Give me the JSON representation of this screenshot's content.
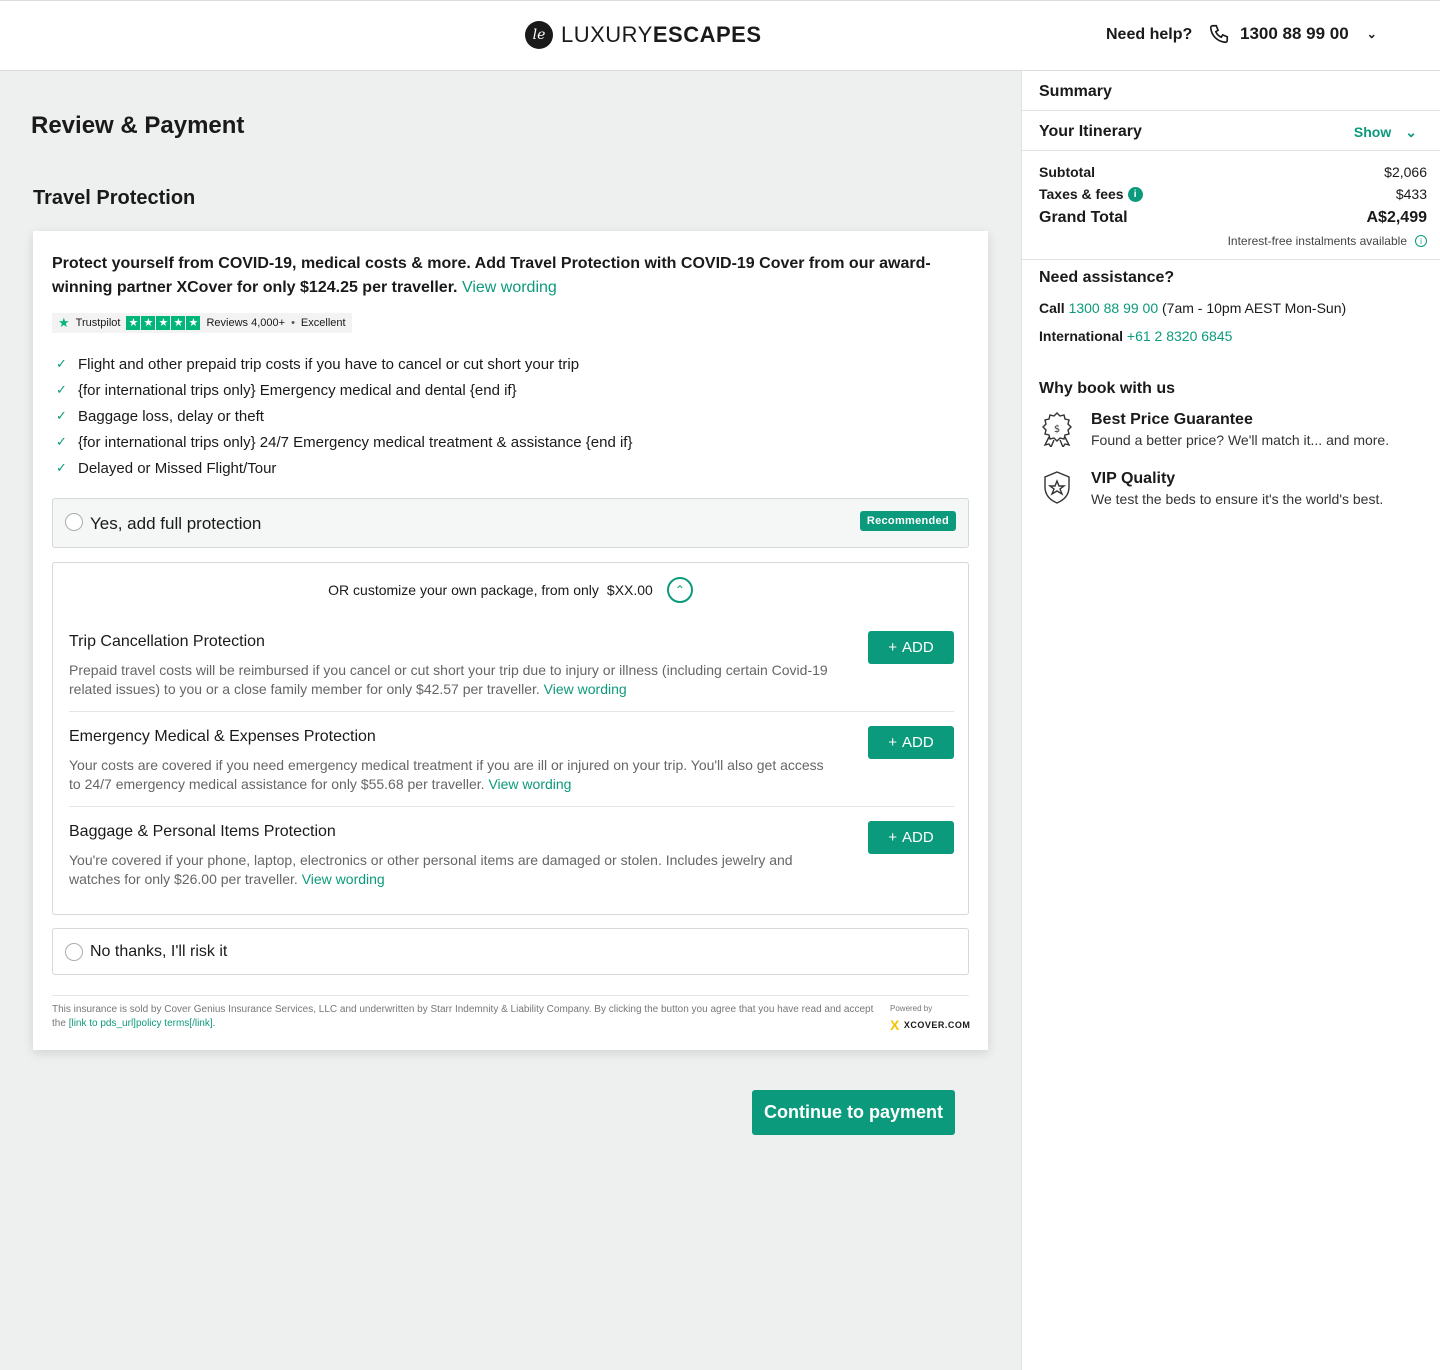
{
  "header": {
    "logo_mark": "le",
    "logo_light": "LUXURY",
    "logo_bold": "ESCAPES",
    "help_label": "Need help?",
    "phone": "1300 88 99 00"
  },
  "main": {
    "page_title": "Review & Payment",
    "section_title": "Travel Protection",
    "intro_text": "Protect yourself from COVID-19, medical costs & more. Add Travel Protection with COVID-19 Cover from our award-winning partner XCover for only $124.25 per traveller.",
    "intro_link": "View wording",
    "trustpilot": {
      "brand": "Trustpilot",
      "reviews": "Reviews 4,000+",
      "rating": "Excellent"
    },
    "features": [
      "Flight and other prepaid trip costs if you have to cancel or cut short your trip",
      "{for international trips only} Emergency medical and dental {end if}",
      "Baggage loss, delay or theft",
      "{for international trips only} 24/7 Emergency medical treatment & assistance {end if}",
      "Delayed or Missed Flight/Tour"
    ],
    "option_yes": "Yes, add full protection",
    "recommended_badge": "Recommended",
    "custom_heading": "OR customize your own package, from only",
    "custom_price": "$XX.00",
    "coverages": [
      {
        "title": "Trip Cancellation Protection",
        "desc": "Prepaid travel costs will be reimbursed if you cancel or cut short your trip due to injury or illness (including certain Covid-19 related issues) to you or a close family member for only $42.57 per traveller.",
        "link": "View wording",
        "button": "ADD"
      },
      {
        "title": "Emergency Medical & Expenses Protection",
        "desc": "Your costs are covered if you need emergency medical treatment if you are ill or injured on your trip. You'll also get access to 24/7 emergency medical assistance for only $55.68 per traveller.",
        "link": "View wording",
        "button": "ADD"
      },
      {
        "title": "Baggage & Personal Items Protection",
        "desc": "You're covered if your phone, laptop, electronics or other personal items are damaged or stolen. Includes jewelry and watches for only $26.00 per traveller.",
        "link": "View wording",
        "button": "ADD"
      }
    ],
    "option_no": "No thanks, I'll risk it",
    "legal_text": "This insurance is sold by Cover Genius Insurance Services, LLC and underwritten by Starr Indemnity & Liability Company. By clicking the button you agree that you have read and accept the",
    "legal_link": "[link to pds_url]policy terms[/link].",
    "powered_by": "Powered by",
    "xcover_brand": "XCOVER.COM",
    "continue_button": "Continue to payment"
  },
  "sidebar": {
    "summary_label": "Summary",
    "itinerary_label": "Your Itinerary",
    "show_label": "Show",
    "subtotal_label": "Subtotal",
    "subtotal_value": "$2,066",
    "taxes_label": "Taxes & fees",
    "taxes_value": "$433",
    "grand_total_label": "Grand Total",
    "grand_total_value": "A$2,499",
    "instalments_note": "Interest-free instalments available",
    "assistance_title": "Need assistance?",
    "call_label": "Call",
    "call_number": "1300 88 99 00",
    "call_hours": "(7am - 10pm AEST Mon-Sun)",
    "intl_label": "International",
    "intl_number": "+61 2 8320 6845",
    "why_title": "Why book with us",
    "why_items": [
      {
        "title": "Best Price Guarantee",
        "desc": "Found a better price? We'll match it... and more.",
        "icon": "price-badge-icon"
      },
      {
        "title": "VIP Quality",
        "desc": "We test the beds to ensure it's the world's best.",
        "icon": "star-shield-icon"
      }
    ]
  },
  "colors": {
    "accent": "#0c9a7c",
    "background": "#eef0ef",
    "trustpilot_green": "#00b67a"
  }
}
